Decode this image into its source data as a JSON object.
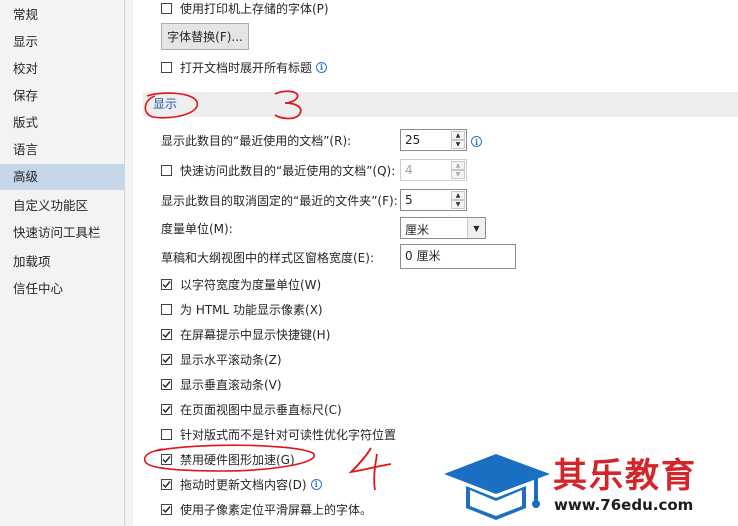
{
  "sidebar": {
    "items": [
      {
        "label": "常规"
      },
      {
        "label": "显示"
      },
      {
        "label": "校对"
      },
      {
        "label": "保存"
      },
      {
        "label": "版式"
      },
      {
        "label": "语言"
      },
      {
        "label": "高级",
        "selected": true
      },
      {
        "label": "自定义功能区"
      },
      {
        "label": "快速访问工具栏"
      },
      {
        "label": "加载项"
      },
      {
        "label": "信任中心"
      }
    ]
  },
  "top": {
    "printer_fonts": {
      "label": "使用打印机上存储的字体(P)",
      "checked": false
    },
    "font_sub_button": "字体替换(F)...",
    "expand_headings": {
      "label": "打开文档时展开所有标题",
      "checked": false
    }
  },
  "display": {
    "section_title": "显示",
    "recent_docs_label": "显示此数目的“最近使用的文档”(R):",
    "recent_docs_value": "25",
    "quick_access_label": "快速访问此数目的“最近使用的文档”(Q):",
    "quick_access_value": "4",
    "quick_access_checked": false,
    "unpinned_folders_label": "显示此数目的取消固定的“最近的文件夹”(F):",
    "unpinned_folders_value": "5",
    "units_label": "度量单位(M):",
    "units_value": "厘米",
    "style_area_label": "草稿和大纲视图中的样式区窗格宽度(E):",
    "style_area_value": "0 厘米",
    "options": [
      {
        "label": "以字符宽度为度量单位(W)",
        "checked": true
      },
      {
        "label": "为 HTML 功能显示像素(X)",
        "checked": false
      },
      {
        "label": "在屏幕提示中显示快捷键(H)",
        "checked": true
      },
      {
        "label": "显示水平滚动条(Z)",
        "checked": true
      },
      {
        "label": "显示垂直滚动条(V)",
        "checked": true
      },
      {
        "label": "在页面视图中显示垂直标尺(C)",
        "checked": true
      },
      {
        "label": "针对版式而不是针对可读性优化字符位置",
        "checked": false
      },
      {
        "label": "禁用硬件图形加速(G)",
        "checked": true
      },
      {
        "label": "拖动时更新文档内容(D)",
        "checked": true
      },
      {
        "label": "使用子像素定位平滑屏幕上的字体。",
        "checked": true
      }
    ]
  },
  "annotations": {
    "mark_three": "3",
    "mark_four": "4"
  },
  "watermark": {
    "brand": "其乐教育",
    "url": "www.76edu.com"
  },
  "colors": {
    "accent": "#1f5aa6",
    "selected_bg": "#c5d6e9",
    "ink": "#e0161d",
    "brand_red": "#d4262a",
    "brand_blue": "#1b6fc2"
  }
}
